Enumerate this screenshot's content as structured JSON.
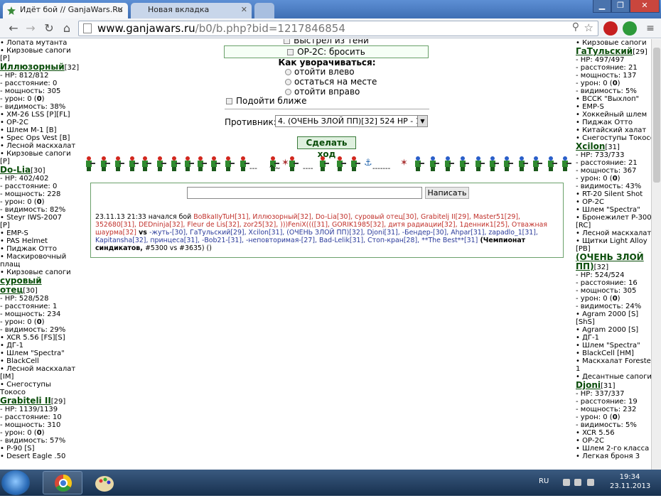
{
  "browser": {
    "tabs": [
      {
        "title": "Идёт бой // GanjaWars.Ru",
        "active": true
      },
      {
        "title": "Новая вкладка",
        "active": false
      }
    ],
    "url_host": "www.ganjawars.ru",
    "url_path": "/b0/b.php?bid=1217846854",
    "win_minimize": "▁",
    "win_maximize": "❐",
    "win_close": "✕"
  },
  "left_column": [
    {
      "lines": [
        "• Лопата мутанта",
        "• Кирзовые сапоги",
        "[P]"
      ]
    },
    {
      "name": "Иллюзорный",
      "level": "[32]",
      "lines": [
        "- HP: 812/812",
        "- расстояние: 0",
        "- мощность: 305",
        "- урон: 0 (0)",
        "- видимость: 38%",
        "• XM-26 LSS [P][FL]",
        "• ОР-2С",
        "• Шлем М-1 [B]",
        "• Spec Ops Vest [B]",
        "• Лесной маскхалат",
        "• Кирзовые сапоги",
        "[P]"
      ]
    },
    {
      "name": "Do-Lia",
      "level": "[30]",
      "lines": [
        "- HP: 402/402",
        "- расстояние: 0",
        "- мощность: 228",
        "- урон: 0 (0)",
        "- видимость: 82%",
        "• Steyr IWS-2007",
        "[P]",
        "• EMP-S",
        "• PAS Helmet",
        "• Пиджак Отто",
        "• Маскировочный",
        "плащ",
        "• Кирзовые сапоги"
      ]
    },
    {
      "name": "суровый",
      "name2": "отец",
      "level": "[30]",
      "lines": [
        "- HP: 528/528",
        "- расстояние: 1",
        "- мощность: 234",
        "- урон: 0 (0)",
        "- видимость: 29%",
        "• XCR 5.56 [FS][S]",
        "• ДГ-1",
        "• Шлем \"Spectra\"",
        "• BlackCell",
        "• Лесной маскхалат",
        "[IM]",
        "• Снегоступы",
        "Токосо"
      ]
    },
    {
      "name": "Grabiteli II",
      "level": "[29]",
      "lines": [
        "- HP: 1139/1139",
        "- расстояние: 10",
        "- мощность: 310",
        "- урон: 0 (0)",
        "- видимость: 57%",
        "• P-90 [S]",
        "• Desert Eagle .50"
      ]
    }
  ],
  "right_column": [
    {
      "lines": [
        "• Кирзовые сапоги"
      ]
    },
    {
      "name": "ГаТульский",
      "level": "[29]",
      "lines": [
        "- HP: 497/497",
        "- расстояние: 21",
        "- мощность: 137",
        "- урон: 0 (0)",
        "- видимость: 5%",
        "• ВССК \"Выхлоп\"",
        "• EMP-S",
        "• Хоккейный шлем",
        "• Пиджак Отто",
        "• Китайский халат",
        "• Снегоступы Токосо"
      ]
    },
    {
      "name": "Xcilon",
      "level": "[31]",
      "lines": [
        "- HP: 733/733",
        "- расстояние: 21",
        "- мощность: 367",
        "- урон: 0 (0)",
        "- видимость: 43%",
        "• RT-20 Silent Shot",
        "• ОР-2С",
        "• Шлем \"Spectra\"",
        "• Бронежилет P-300",
        "[RC]",
        "• Лесной маскхалат",
        "• Щитки Light Alloy",
        "[PB]"
      ]
    },
    {
      "name": "(ОЧЕНЬ ЗЛОЙ ПП)",
      "level": "[32]",
      "lines": [
        "- HP: 524/524",
        "- расстояние: 16",
        "- мощность: 305",
        "- урон: 0 (0)",
        "- видимость: 24%",
        "• Agram 2000 [S]",
        "[ShS]",
        "• Agram 2000 [S]",
        "• ДГ-1",
        "• Шлем \"Spectra\"",
        "• BlackCell [HM]",
        "• Маскхалат Foreste",
        "1",
        "• Десантные сапоги"
      ]
    },
    {
      "name": "Djoni",
      "level": "[31]",
      "lines": [
        "- HP: 337/337",
        "- расстояние: 19",
        "- мощность: 232",
        "- урон: 0 (0)",
        "- видимость: 5%",
        "• XCR 5.56",
        "• ОР-2С",
        "• Шлем 2-го класса",
        "• Легкая броня 3"
      ]
    }
  ],
  "battle": {
    "opt_shadow": "Выстрел из тени",
    "opt_grenade": "ОР-2С: бросить",
    "dodge_title": "Как уворачиваться:",
    "dodge_left": "отойти влево",
    "dodge_stay": "остаться на месте",
    "dodge_right": "отойти вправо",
    "approach": "Подойти ближе",
    "enemy_label": "Противник:",
    "enemy_value": "4. (ОЧЕНЬ ЗЛОЙ ПП)[32] 524 HP - 16",
    "make_move": "Сделать ход",
    "send": "Написать"
  },
  "log": {
    "start": "23.11.13 21:33 начался бой ",
    "team1": "BoBkaIIyTuH[31], Иллюзорный[32], Do-Lia[30], суровый отец[30], Grabitelj II[29], Master51[29], 352680[31], DEDninja[32], Fleur de Lis[32], zor25[32], )))FeniX((([31], GORIK1985[32], дитя радиации[32], 1денник1[25], Отважная шаурма[32]",
    "vs": " vs ",
    "team2": "-жуть-[30], ГаТульский[29], Xcilon[31], (ОЧЕНЬ ЗЛОЙ ПП)[32], Djoni[31], -Бендер-[30], Ahpar[31], zapadlo_1[31], Kapitansha[32], принцеса[31], -Bob21-[31], -неповторимая-[27], Bad-Lelik[31], Стоп-кран[28], **The Best**[31]",
    "champ": " (Чемпионат синдикатов, ",
    "score": "#5300 vs #3635",
    "end": ") ()"
  },
  "taskbar": {
    "lang": "RU",
    "time": "19:34",
    "date": "23.11.2013"
  }
}
